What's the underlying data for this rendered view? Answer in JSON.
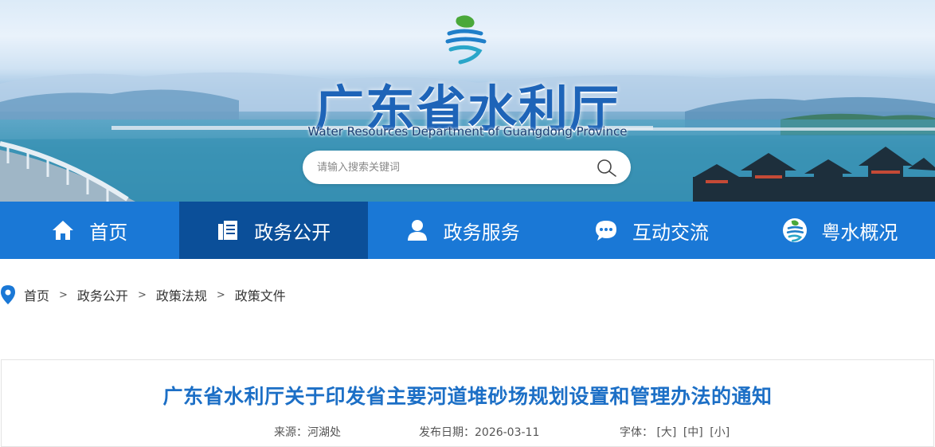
{
  "header": {
    "title": "广东省水利厅",
    "subtitle": "Water Resources Department of Guangdong Province",
    "logo_icon": "yue-water-logo-icon"
  },
  "search": {
    "placeholder": "请输入搜索关键词",
    "icon": "search-icon"
  },
  "nav": {
    "items": [
      {
        "label": "首页",
        "icon": "home-icon",
        "active": false
      },
      {
        "label": "政务公开",
        "icon": "document-icon",
        "active": true
      },
      {
        "label": "政务服务",
        "icon": "user-icon",
        "active": false
      },
      {
        "label": "互动交流",
        "icon": "chat-icon",
        "active": false
      },
      {
        "label": "粤水概况",
        "icon": "yue-water-logo-icon",
        "active": false
      }
    ]
  },
  "breadcrumb": {
    "icon": "location-pin-icon",
    "items": [
      "首页",
      "政务公开",
      "政策法规",
      "政策文件"
    ],
    "separator": ">"
  },
  "article": {
    "title": "广东省水利厅关于印发省主要河道堆砂场规划设置和管理办法的通知",
    "source_label": "来源：",
    "source_value": "河湖处",
    "date_label": "发布日期：",
    "date_value": "2026-03-11",
    "font_label": "字体：",
    "font_sizes": [
      "[大]",
      "[中]",
      "[小]"
    ]
  },
  "colors": {
    "nav_bg": "#1a78d6",
    "nav_active_bg": "#0b4f99",
    "title_blue": "#1c6fc6",
    "brand_blue": "#1e64b8"
  }
}
